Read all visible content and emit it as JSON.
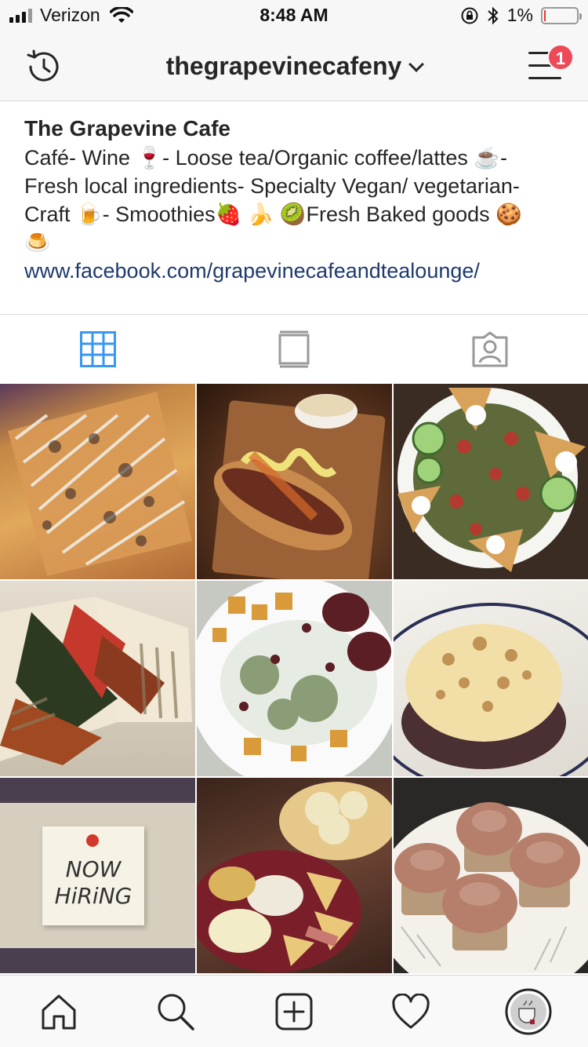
{
  "status_bar": {
    "carrier": "Verizon",
    "time": "8:48 AM",
    "battery": "1%"
  },
  "header": {
    "username": "thegrapevinecafeny",
    "notification_count": "1"
  },
  "bio": {
    "name": "The Grapevine Cafe",
    "lines": [
      "Café- Wine 🍷- Loose tea/Organic coffee/lattes ☕-",
      "Fresh local ingredients- Specialty Vegan/ vegetarian-",
      "Craft 🍺- Smoothies🍓 🍌 🥝Fresh Baked goods 🍪",
      "🍮"
    ],
    "link": "www.facebook.com/grapevinecafeandtealounge/"
  },
  "tabs": {
    "active": "grid",
    "items": [
      "grid",
      "feed",
      "tagged"
    ]
  },
  "posts": [
    {
      "alt": "flatbread",
      "bg": "#b5783f"
    },
    {
      "alt": "sausage-sandwich",
      "bg": "#5a3521"
    },
    {
      "alt": "salad",
      "bg": "#3f2e23"
    },
    {
      "alt": "wrap",
      "bg": "#d8cfc0"
    },
    {
      "alt": "vegetable-plate",
      "bg": "#cbd0c8"
    },
    {
      "alt": "stuffed-mushroom",
      "bg": "#e9e6df"
    },
    {
      "alt": "now-hiring",
      "bg": "#cfc6b5",
      "text_line1": "NOW",
      "text_line2": "HiRiNG"
    },
    {
      "alt": "appetizer-platter",
      "bg": "#5c3a2c"
    },
    {
      "alt": "cupcakes",
      "bg": "#2c2a28"
    }
  ],
  "colors": {
    "accent_blue": "#3897f0",
    "link": "#1e3a6e",
    "badge": "#ed4956"
  }
}
